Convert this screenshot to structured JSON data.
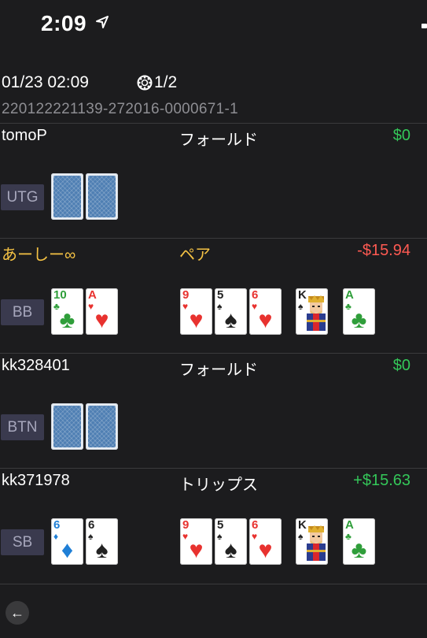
{
  "status_bar": {
    "time": "2:09"
  },
  "header": {
    "datetime": "01/23 02:09",
    "page": "1/2",
    "hand_id": "220122221139-272016-0000671-1"
  },
  "players": [
    {
      "name": "tomoP",
      "hand": "フォールド",
      "result": "$0",
      "result_color": "#34c759",
      "name_color": "#ffffff",
      "position": "UTG",
      "hole_cards": [
        {
          "back": true
        },
        {
          "back": true
        }
      ],
      "board": []
    },
    {
      "name": "あーしー∞",
      "hand": "ペア",
      "result": "-$15.94",
      "result_color": "#ff5a52",
      "name_color": "#f5c244",
      "position": "BB",
      "hole_cards": [
        {
          "rank": "10",
          "suit": "clubs",
          "symbol": "♣"
        },
        {
          "rank": "A",
          "suit": "hearts",
          "symbol": "♥"
        }
      ],
      "board": [
        {
          "rank": "9",
          "suit": "hearts",
          "symbol": "♥"
        },
        {
          "rank": "5",
          "suit": "spades",
          "symbol": "♠"
        },
        {
          "rank": "6",
          "suit": "hearts",
          "symbol": "♥"
        },
        {
          "rank": "K",
          "suit": "spades",
          "symbol": "♠",
          "face": "king"
        },
        {
          "rank": "A",
          "suit": "clubs",
          "symbol": "♣"
        }
      ]
    },
    {
      "name": "kk328401",
      "hand": "フォールド",
      "result": "$0",
      "result_color": "#34c759",
      "name_color": "#ffffff",
      "position": "BTN",
      "hole_cards": [
        {
          "back": true
        },
        {
          "back": true
        }
      ],
      "board": []
    },
    {
      "name": "kk371978",
      "hand": "トリップス",
      "result": "+$15.63",
      "result_color": "#34c759",
      "name_color": "#ffffff",
      "position": "SB",
      "hole_cards": [
        {
          "rank": "6",
          "suit": "diamonds",
          "symbol": "♦"
        },
        {
          "rank": "6",
          "suit": "spades",
          "symbol": "♠"
        }
      ],
      "board": [
        {
          "rank": "9",
          "suit": "hearts",
          "symbol": "♥"
        },
        {
          "rank": "5",
          "suit": "spades",
          "symbol": "♠"
        },
        {
          "rank": "6",
          "suit": "hearts",
          "symbol": "♥"
        },
        {
          "rank": "K",
          "suit": "spades",
          "symbol": "♠",
          "face": "king"
        },
        {
          "rank": "A",
          "suit": "clubs",
          "symbol": "♣"
        }
      ]
    }
  ],
  "icons": {
    "location": "location-arrow-icon",
    "chip": "poker-chip-icon",
    "back": "back-arrow-icon"
  },
  "back_glyph": "←"
}
